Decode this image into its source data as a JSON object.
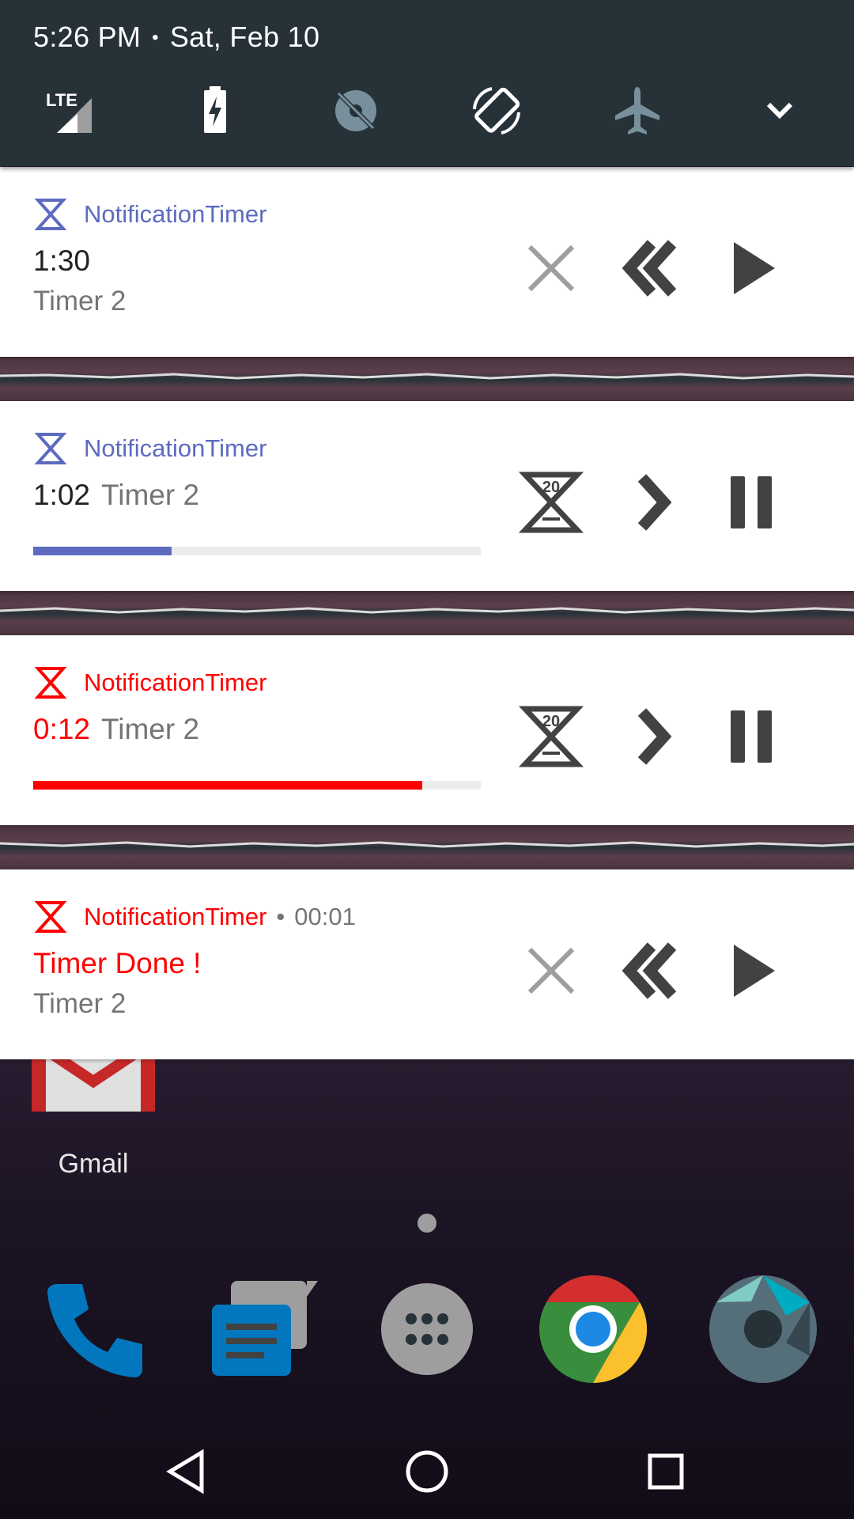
{
  "status": {
    "time": "5:26 PM",
    "separator": "•",
    "date": "Sat, Feb 10",
    "network_label": "LTE"
  },
  "quick_settings": {
    "icons": [
      "lte-signal-icon",
      "battery-charging-icon",
      "location-off-icon",
      "auto-rotate-icon",
      "airplane-mode-icon",
      "chevron-down-icon"
    ]
  },
  "notifications": [
    {
      "app_name": "NotificationTimer",
      "title": "1:30",
      "subtitle": "Timer 2",
      "accent": "#5c6bc0",
      "actions": [
        "close-icon",
        "rewind-icon",
        "play-icon"
      ]
    },
    {
      "app_name": "NotificationTimer",
      "title": "1:02",
      "subtitle": "Timer 2",
      "accent": "#5c6bc0",
      "progress": 0.31,
      "add_time_label": "20",
      "actions": [
        "hourglass-20-icon",
        "next-icon",
        "pause-icon"
      ]
    },
    {
      "app_name": "NotificationTimer",
      "title": "0:12",
      "subtitle": "Timer 2",
      "accent": "#ff0000",
      "progress": 0.87,
      "add_time_label": "20",
      "actions": [
        "hourglass-20-icon",
        "next-icon",
        "pause-icon"
      ]
    },
    {
      "app_name": "NotificationTimer",
      "time_separator": "•",
      "time": "00:01",
      "title": "Timer Done !",
      "subtitle": "Timer 2",
      "accent": "#ff0000",
      "actions": [
        "close-icon",
        "rewind-icon",
        "play-icon"
      ]
    }
  ],
  "home": {
    "gmail_label": "Gmail",
    "dock": [
      "phone",
      "messages",
      "app-drawer",
      "chrome",
      "camera"
    ]
  },
  "colors": {
    "status_bar": "#263238",
    "indigo": "#5c6bc0",
    "red": "#ff0000"
  }
}
